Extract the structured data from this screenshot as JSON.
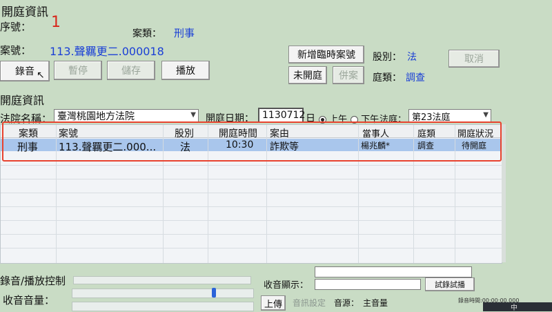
{
  "window": {
    "title": "開庭資訊"
  },
  "seq": {
    "label": "序號：",
    "value": "1"
  },
  "case_type": {
    "label": "案類：",
    "value": "刑事"
  },
  "case_no": {
    "label": "案號：",
    "value": "113.聲羈更二.000018"
  },
  "toolbar": {
    "record": "錄音",
    "pause": "暫停",
    "save": "儲存",
    "play": "播放"
  },
  "right_panel": {
    "add_temp_case": "新增臨時案號",
    "division_label": "股別：",
    "division_value": "法",
    "cancel": "取消",
    "not_opened": "未開庭",
    "merge_case": "併案",
    "court_type_label": "庭類：",
    "court_type_value": "調查"
  },
  "section": {
    "session_info": "開庭資訊"
  },
  "filters": {
    "court_name_label": "法院名稱：",
    "court_name_value": "臺灣桃園地方法院",
    "date_label": "開庭日期：",
    "date_value": "1130712",
    "day_suffix": "日",
    "am_label": "上午",
    "pm_label": "下午",
    "am_selected": true,
    "courtroom_label": "法庭：",
    "courtroom_value": "第23法庭"
  },
  "table": {
    "columns": [
      "案類",
      "案號",
      "股別",
      "開庭時間",
      "案由",
      "當事人",
      "庭類",
      "開庭狀況"
    ],
    "rows": [
      [
        "刑事",
        "113.聲羈更二.000...",
        "法",
        "10:30",
        "詐欺等",
        "楊兆麟*",
        "調查",
        "待開庭"
      ]
    ]
  },
  "playback": {
    "title": "錄音/播放控制",
    "rec_volume_label": "收音音量：",
    "rec_display_label": "收音顯示：",
    "test_record": "試錄試播",
    "upload": "上傳",
    "audio_setting": "音訊設定",
    "source_label": "音源：",
    "source_value": "主音量",
    "record_time": "錄音時間:00:00:00.000"
  },
  "taskbar": {
    "ime": "中"
  },
  "colors": {
    "selected_row": "#a9c6ec",
    "highlight_border": "#e8422e",
    "accent_blue": "#1a3fd6"
  }
}
